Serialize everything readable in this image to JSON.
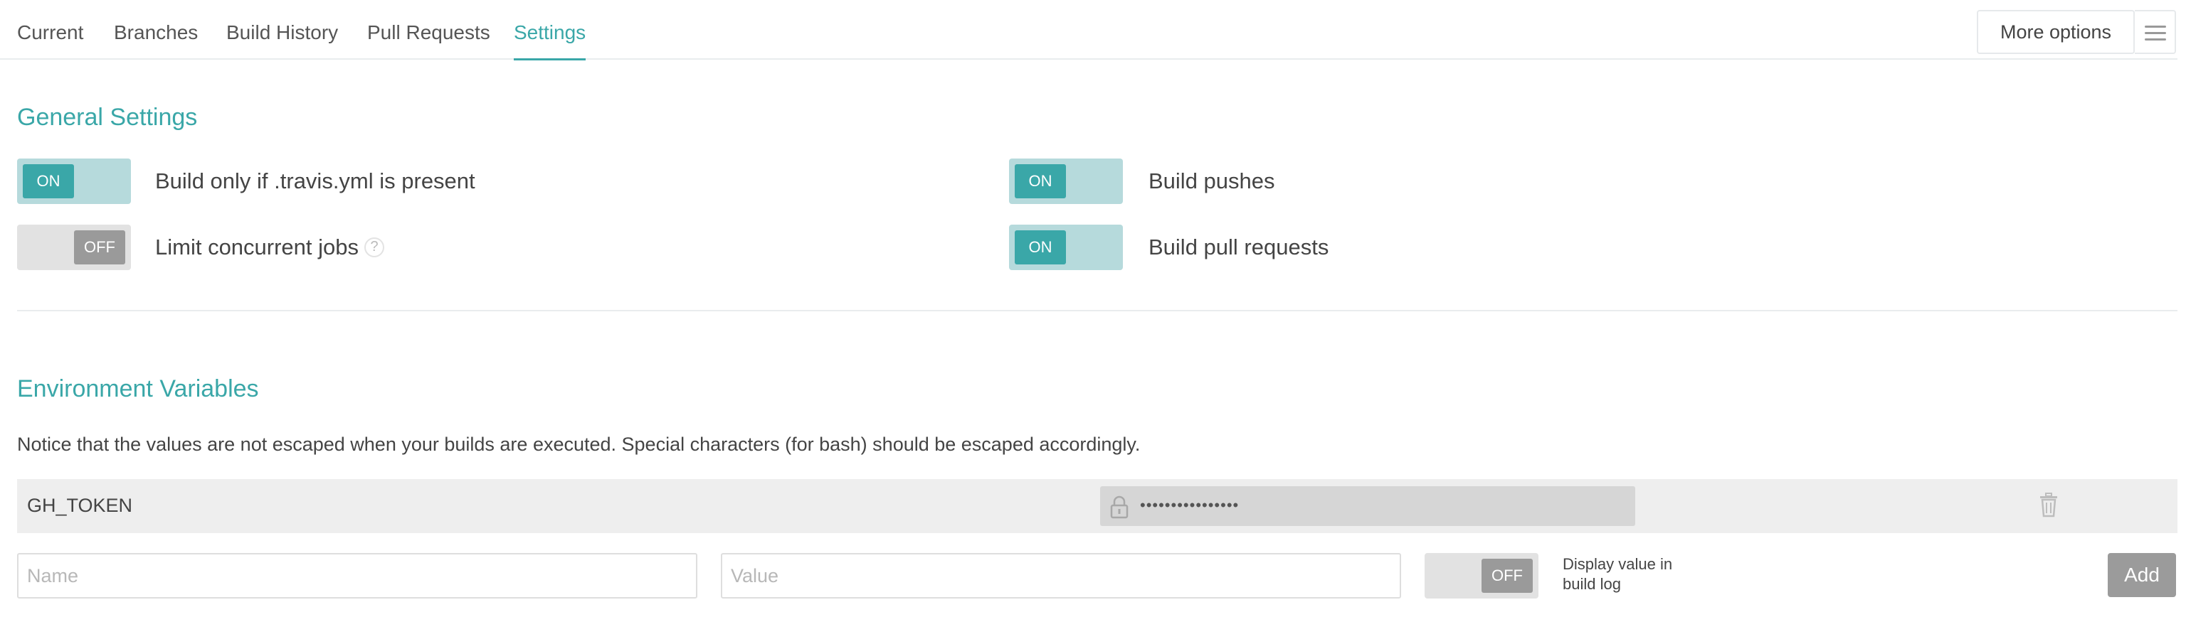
{
  "tabs": [
    {
      "label": "Current"
    },
    {
      "label": "Branches"
    },
    {
      "label": "Build History"
    },
    {
      "label": "Pull Requests"
    },
    {
      "label": "Settings",
      "active": true
    }
  ],
  "header": {
    "more_options_label": "More options",
    "menu_icon": "hamburger-icon"
  },
  "general_settings": {
    "title": "General Settings",
    "settings": [
      {
        "label": "Build only if .travis.yml is present",
        "state": "ON"
      },
      {
        "label": "Limit concurrent jobs",
        "state": "OFF",
        "help": "?"
      },
      {
        "label": "Build pushes",
        "state": "ON"
      },
      {
        "label": "Build pull requests",
        "state": "ON"
      }
    ]
  },
  "environment_variables": {
    "title": "Environment Variables",
    "notice": "Notice that the values are not escaped when your builds are executed. Special characters (for bash) should be escaped accordingly.",
    "variables": [
      {
        "name": "GH_TOKEN",
        "value": "••••••••••••••••",
        "icon": "lock-icon",
        "delete_icon": "trash-icon"
      }
    ],
    "new_variable": {
      "name_placeholder": "Name",
      "value_placeholder": "Value",
      "display_toggle_state": "OFF",
      "display_label": "Display value in build log",
      "add_label": "Add"
    }
  },
  "colors": {
    "accent": "#3aa7a8",
    "toggle_on_track": "#b6dadc",
    "toggle_off_knob": "#9a9a9a",
    "add_button": "#9b9b9b"
  }
}
